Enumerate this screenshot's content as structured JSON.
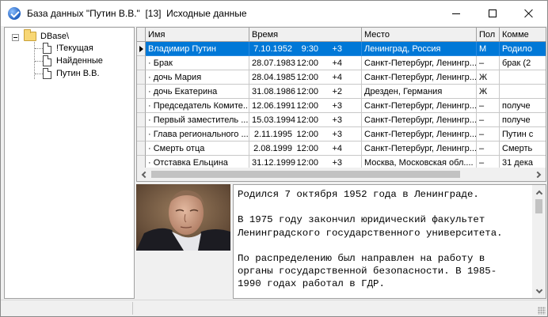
{
  "window": {
    "title": "База данных \"Путин В.В.\"  [13]  Исходные данные"
  },
  "tree": {
    "root": "DBase\\",
    "children": [
      "!Текущая",
      "Найденные",
      "Путин В.В."
    ]
  },
  "grid": {
    "columns": [
      "Имя",
      "Время",
      "Место",
      "Пол",
      "Комме"
    ],
    "rows": [
      {
        "name": "Владимир Путин",
        "date": "7.10.1952",
        "time": "9:30",
        "tz": "+3",
        "place": "Ленинград, Россия",
        "sex": "М",
        "comment": "Родило"
      },
      {
        "name": "· Брак",
        "date": "28.07.1983",
        "time": "12:00",
        "tz": "+4",
        "place": "Санкт-Петербург, Ленингр...",
        "sex": "–",
        "comment": "брак (2"
      },
      {
        "name": "· дочь Мария",
        "date": "28.04.1985",
        "time": "12:00",
        "tz": "+4",
        "place": "Санкт-Петербург, Ленингр...",
        "sex": "Ж",
        "comment": ""
      },
      {
        "name": "· дочь Екатерина",
        "date": "31.08.1986",
        "time": "12:00",
        "tz": "+2",
        "place": "Дрезден, Германия",
        "sex": "Ж",
        "comment": ""
      },
      {
        "name": "· Председатель Комите...",
        "date": "12.06.1991",
        "time": "12:00",
        "tz": "+3",
        "place": "Санкт-Петербург, Ленингр...",
        "sex": "–",
        "comment": "получе"
      },
      {
        "name": "· Первый заместитель ...",
        "date": "15.03.1994",
        "time": "12:00",
        "tz": "+3",
        "place": "Санкт-Петербург, Ленингр...",
        "sex": "–",
        "comment": "получе"
      },
      {
        "name": "· Глава регионального ...",
        "date": "2.11.1995",
        "time": "12:00",
        "tz": "+3",
        "place": "Санкт-Петербург, Ленингр...",
        "sex": "–",
        "comment": "Путин с"
      },
      {
        "name": "· Смерть отца",
        "date": "2.08.1999",
        "time": "12:00",
        "tz": "+4",
        "place": "Санкт-Петербург, Ленингр...",
        "sex": "–",
        "comment": "Смерть"
      },
      {
        "name": "· Отставка Ельцина",
        "date": "31.12.1999",
        "time": "12:00",
        "tz": "+3",
        "place": "Москва, Московская обл....",
        "sex": "–",
        "comment": "31 дека"
      }
    ]
  },
  "memo": {
    "text": "Родился 7 октября 1952 года в Ленинграде.\n\nВ 1975 году закончил юридический факультет\nЛенинградского государственного университета.\n\nПо распределению был направлен на работу в\nорганы государственной безопасности. В 1985-\n1990 годах работал в ГДР."
  },
  "icons": {
    "app": "app-logo-icon",
    "folder": "folder-icon",
    "document": "document-icon"
  },
  "colors": {
    "selection": "#0078d7",
    "window_bg": "#f0f0f0"
  }
}
